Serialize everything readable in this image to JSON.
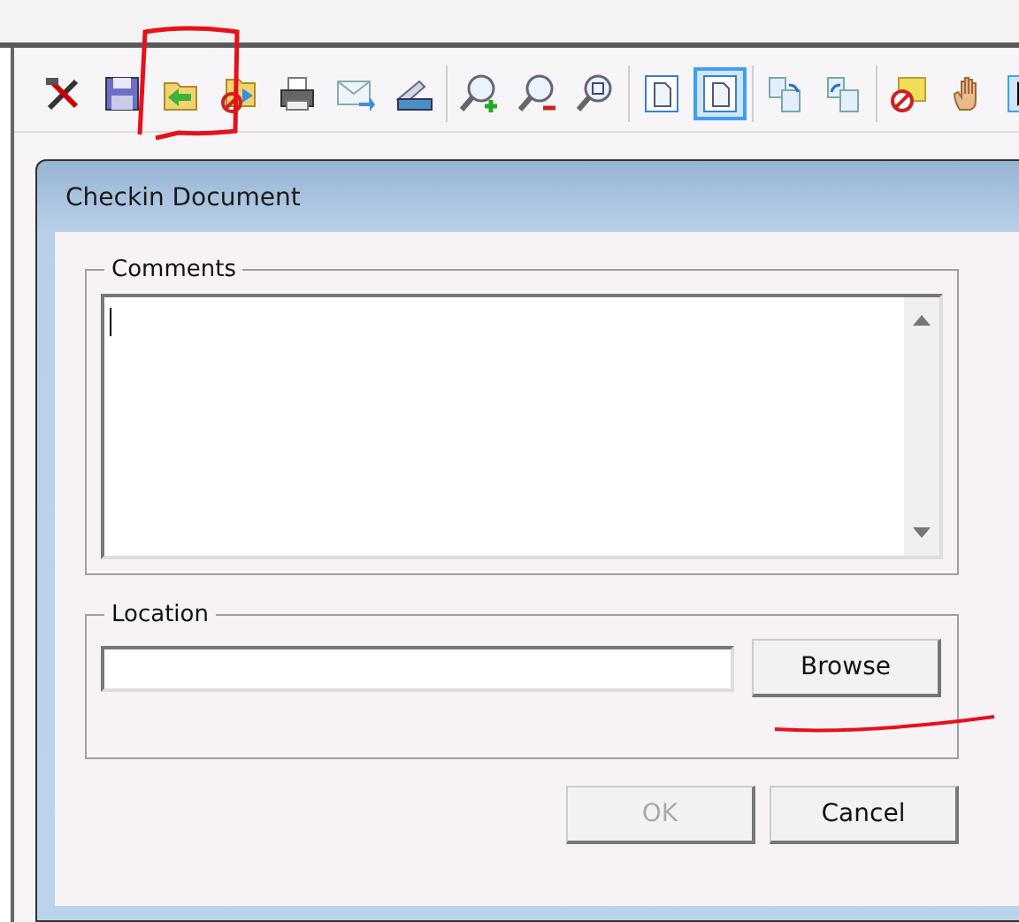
{
  "toolbar": {
    "groups": [
      [
        {
          "kind": "tools",
          "selected": false
        },
        {
          "kind": "save",
          "selected": false
        },
        {
          "kind": "checkin",
          "selected": false
        },
        {
          "kind": "checkout",
          "selected": false
        },
        {
          "kind": "print",
          "selected": false
        },
        {
          "kind": "email",
          "selected": false
        },
        {
          "kind": "scan",
          "selected": false
        }
      ],
      [
        {
          "kind": "zoom-in",
          "selected": false
        },
        {
          "kind": "zoom-out",
          "selected": false
        },
        {
          "kind": "zoom-fit",
          "selected": false
        }
      ],
      [
        {
          "kind": "page",
          "selected": false
        },
        {
          "kind": "page-fit",
          "selected": true
        }
      ],
      [
        {
          "kind": "rotate-left",
          "selected": false
        },
        {
          "kind": "rotate-right",
          "selected": false
        }
      ],
      [
        {
          "kind": "cancel",
          "selected": false
        },
        {
          "kind": "hand",
          "selected": false
        },
        {
          "kind": "next",
          "selected": false
        }
      ]
    ]
  },
  "dialog": {
    "title": "Checkin Document",
    "comments": {
      "label": "Comments"
    },
    "location": {
      "label": "Location",
      "browse": {
        "label": "Browse",
        "disabled": false
      }
    },
    "buttons": [
      {
        "label": "OK",
        "disabled": true
      },
      {
        "label": "Cancel",
        "disabled": false
      }
    ]
  },
  "annotations": [
    {
      "kind": "box"
    },
    {
      "kind": "underline"
    }
  ]
}
